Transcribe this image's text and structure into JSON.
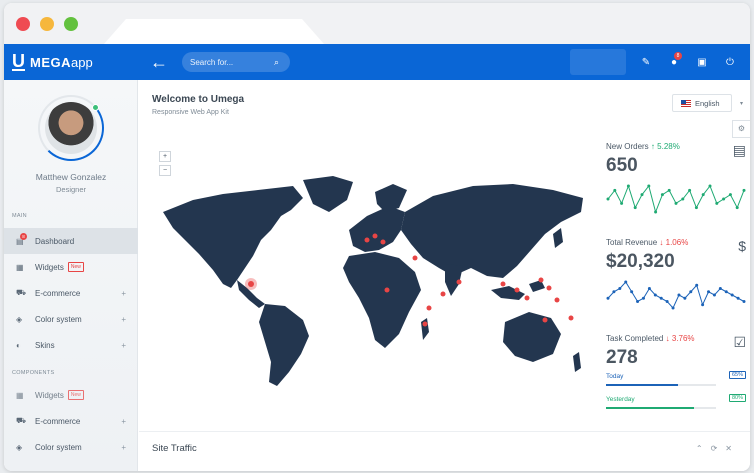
{
  "window": {
    "controls": [
      "close",
      "minimize",
      "maximize"
    ]
  },
  "brand": {
    "mega": "MEGA",
    "app": "app"
  },
  "header": {
    "search_placeholder": "Search for...",
    "notifications_badge": "8"
  },
  "sidebar": {
    "user": {
      "name": "Matthew Gonzalez",
      "role": "Designer"
    },
    "main_section": "MAIN",
    "components_section": "COMPONENTS",
    "items": [
      {
        "label": "Dashboard",
        "icon": "dashboard-icon",
        "badge": "8"
      },
      {
        "label": "Widgets",
        "icon": "widgets-icon",
        "tag": "New"
      },
      {
        "label": "E-commerce",
        "icon": "cart-icon"
      },
      {
        "label": "Color system",
        "icon": "paint-bucket-icon"
      },
      {
        "label": "Skins",
        "icon": "skins-icon"
      }
    ],
    "component_items": [
      {
        "label": "Widgets",
        "tag": "New"
      },
      {
        "label": "E-commerce"
      },
      {
        "label": "Color system"
      }
    ]
  },
  "main": {
    "welcome": "Welcome to Umega",
    "subtitle": "Responsive Web App Kit",
    "language": "English",
    "zoom_in": "+",
    "zoom_out": "−",
    "stats": {
      "orders": {
        "label": "New Orders",
        "change": "5.28%",
        "value": "650",
        "trend": [
          6,
          8,
          5,
          9,
          4,
          7,
          9,
          3,
          7,
          8,
          5,
          6,
          8,
          4,
          7,
          9,
          5,
          6,
          7,
          4,
          8
        ]
      },
      "revenue": {
        "label": "Total Revenue",
        "change": "1.06%",
        "value": "$20,320",
        "trend": [
          4,
          6,
          7,
          9,
          6,
          3,
          4,
          7,
          5,
          4,
          3,
          1,
          5,
          4,
          6,
          8,
          2,
          6,
          5,
          7,
          6,
          5,
          4,
          3
        ]
      },
      "tasks": {
        "label": "Task Completed",
        "change": "3.76%",
        "value": "278"
      }
    },
    "progress": [
      {
        "label": "Today",
        "percent": 65,
        "percent_label": "65%",
        "color": "#1c63b8"
      },
      {
        "label": "Yesterday",
        "percent": 80,
        "percent_label": "80%",
        "color": "#1faa73"
      }
    ],
    "traffic_title": "Site Traffic"
  },
  "colors": {
    "accent": "#0a66d6",
    "map_land": "#23364f",
    "marker": "#e84545",
    "spark_green": "#1faa73",
    "spark_blue": "#1c63b8"
  }
}
